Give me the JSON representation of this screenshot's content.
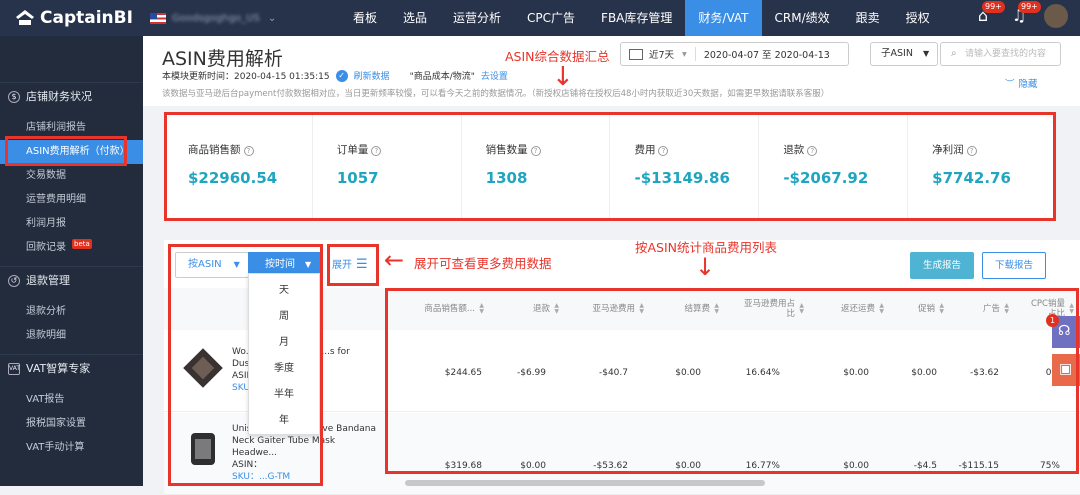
{
  "app": {
    "logo_text": "CaptainBI",
    "account_name": "Goodsgoghgo_US"
  },
  "nav": {
    "items": [
      "看板",
      "选品",
      "运营分析",
      "CPC广告",
      "FBA库存管理",
      "财务/VAT",
      "CRM/绩效",
      "跟卖",
      "授权"
    ],
    "active": "财务/VAT",
    "badge1": "99+",
    "badge2": "99+"
  },
  "sidebar": {
    "groups": [
      {
        "title": "店铺财务状况",
        "items": [
          "店铺利润报告",
          "ASIN费用解析（付款）",
          "交易数据",
          "运营费用明细",
          "利润月报",
          "回款记录"
        ]
      },
      {
        "title": "退款管理",
        "items": [
          "退款分析",
          "退款明细"
        ]
      },
      {
        "title": "VAT智算专家",
        "items": [
          "VAT报告",
          "报税国家设置",
          "VAT手动计算"
        ]
      }
    ],
    "beta_label": "beta"
  },
  "header": {
    "title": "ASIN费用解析",
    "update_label": "本模块更新时间：2020-04-15 01:35:15",
    "refresh": "刷新数据",
    "cost_label": "\"商品成本/物流\"",
    "cost_link": "去设置",
    "description": "该数据与亚马逊后台payment付款数据相对应，当日更新频率较慢，可以看今天之前的数据情况。（新授权店铺将在授权后48小时内获取近30天数据，如需更早数据请联系客服）",
    "range_select": "近7天",
    "date_range": "2020-04-07 至 2020-04-13",
    "asin_select": "子ASIN",
    "search_placeholder": "请输入要查找的内容",
    "hide": "隐藏"
  },
  "summary": [
    {
      "label": "商品销售额",
      "value": "$22960.54"
    },
    {
      "label": "订单量",
      "value": "1057"
    },
    {
      "label": "销售数量",
      "value": "1308"
    },
    {
      "label": "费用",
      "value": "-$13149.86"
    },
    {
      "label": "退款",
      "value": "-$2067.92"
    },
    {
      "label": "净利润",
      "value": "$7742.76"
    }
  ],
  "toolbar": {
    "by_asin": "按ASIN",
    "by_time": "按时间",
    "expand": "展开",
    "generate": "生成报告",
    "download": "下载报告"
  },
  "time_options": [
    "天",
    "周",
    "月",
    "季度",
    "半年",
    "年"
  ],
  "table": {
    "columns": [
      "商品销售额...",
      "退款",
      "亚马逊费用",
      "结算费",
      "亚马逊费用占比",
      "返还运费",
      "促销",
      "广告",
      "CPC销量占比"
    ],
    "rows": [
      {
        "title": "Wo...  ...wboy Ban...  ...s for Dust...",
        "asin": "ASIN：...Q",
        "sku": "SKU：...G-TM",
        "values": [
          "$244.65",
          "-$6.99",
          "-$40.7",
          "$0.00",
          "16.64%",
          "$0.00",
          "$0.00",
          "-$3.62",
          "0%"
        ]
      },
      {
        "title": "Unisex Seamless Rave Bandana Neck Gaiter Tube Mask Headwe...",
        "asin": "ASIN：",
        "sku": "SKU：...G-TM",
        "values": [
          "$319.68",
          "$0.00",
          "-$53.62",
          "$0.00",
          "16.77%",
          "$0.00",
          "-$4.5",
          "-$115.15",
          "75%"
        ]
      }
    ]
  },
  "annotations": {
    "summary_note": "ASIN综合数据汇总",
    "expand_note": "展开可查看更多费用数据",
    "list_note": "按ASIN统计商品费用列表"
  },
  "float": {
    "badge": "1"
  }
}
